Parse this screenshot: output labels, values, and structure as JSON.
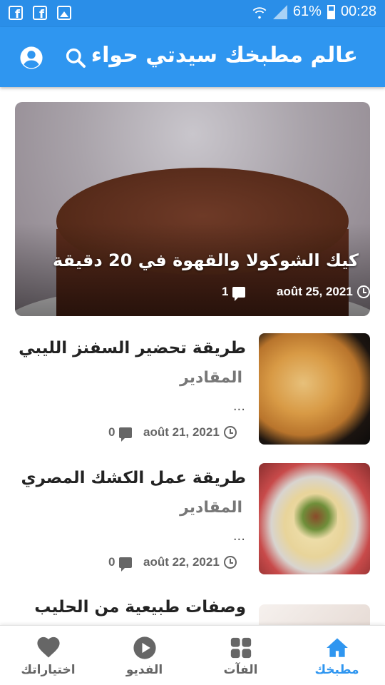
{
  "status_bar": {
    "battery": "61%",
    "time": "00:28",
    "icons": [
      "facebook-icon",
      "facebook-icon",
      "image-icon",
      "wifi-icon",
      "signal-icon",
      "battery-icon"
    ]
  },
  "app_bar": {
    "title": "عالم مطبخك سيدتي حواء",
    "icons": [
      "account-icon",
      "search-icon"
    ]
  },
  "featured": {
    "title": "كيك الشوكولا والقهوة في 20 دقيقة",
    "date": "août 25, 2021",
    "comments": "1"
  },
  "articles": [
    {
      "title": "طريقة تحضير السفنز الليبي",
      "excerpt": "المقادير",
      "ellipsis": "...",
      "date": "août 21, 2021",
      "comments": "0"
    },
    {
      "title": "طريقة عمل الكشك المصري",
      "excerpt": "المقادير",
      "ellipsis": "...",
      "date": "août 22, 2021",
      "comments": "0"
    },
    {
      "title": "وصفات طبيعية من الحليب"
    }
  ],
  "bottom_nav": [
    {
      "label": "مطبخك",
      "icon": "home-icon",
      "active": true
    },
    {
      "label": "الفآت",
      "icon": "grid-icon"
    },
    {
      "label": "الفديو",
      "icon": "play-icon"
    },
    {
      "label": "اختياراتك",
      "icon": "heart-icon"
    }
  ],
  "colors": {
    "accent": "#2f96f0",
    "status_bar": "#2a8ee8",
    "text": "#222222"
  }
}
